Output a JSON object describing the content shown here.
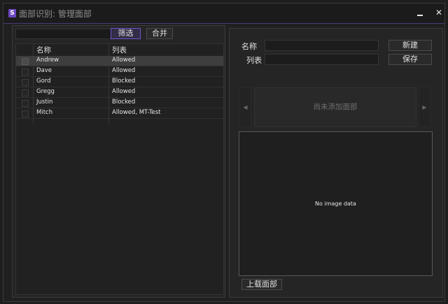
{
  "window": {
    "title": "面部识别: 管理面部",
    "app_icon_letter": "S"
  },
  "toolbar": {
    "filter_label": "筛选",
    "merge_label": "合并"
  },
  "table": {
    "columns": [
      "名称",
      "列表"
    ],
    "rows": [
      {
        "name": "Andrew",
        "list": "Allowed",
        "selected": true
      },
      {
        "name": "Dave",
        "list": "Allowed",
        "selected": false
      },
      {
        "name": "Gord",
        "list": "Blocked",
        "selected": false
      },
      {
        "name": "Gregg",
        "list": "Allowed",
        "selected": false
      },
      {
        "name": "Justin",
        "list": "Blocked",
        "selected": false
      },
      {
        "name": "Mitch",
        "list": "Allowed, MT-Test",
        "selected": false
      }
    ]
  },
  "detail": {
    "name_label": "名称",
    "list_label": "列表",
    "new_button": "新建",
    "save_button": "保存",
    "no_faces_text": "尚未添加面部",
    "no_image_text": "No image data",
    "upload_button": "上载面部"
  },
  "colors": {
    "accent": "#7257c8",
    "title_border": "#4b3a78"
  }
}
